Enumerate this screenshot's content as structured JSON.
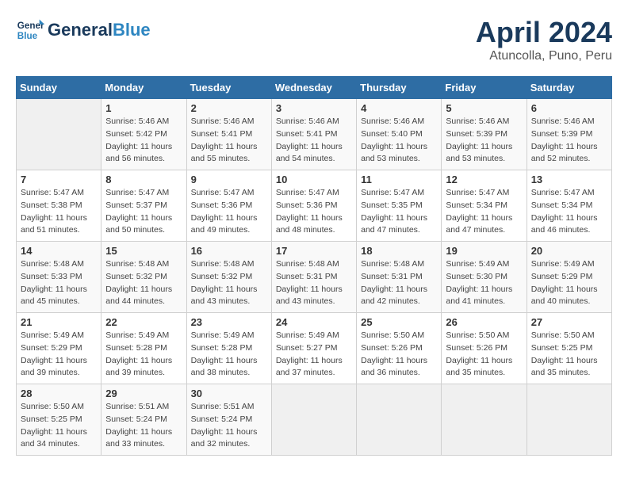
{
  "header": {
    "logo_line1": "General",
    "logo_line2": "Blue",
    "title": "April 2024",
    "subtitle": "Atuncolla, Puno, Peru"
  },
  "weekdays": [
    "Sunday",
    "Monday",
    "Tuesday",
    "Wednesday",
    "Thursday",
    "Friday",
    "Saturday"
  ],
  "weeks": [
    [
      {
        "day": "",
        "info": ""
      },
      {
        "day": "1",
        "info": "Sunrise: 5:46 AM\nSunset: 5:42 PM\nDaylight: 11 hours\nand 56 minutes."
      },
      {
        "day": "2",
        "info": "Sunrise: 5:46 AM\nSunset: 5:41 PM\nDaylight: 11 hours\nand 55 minutes."
      },
      {
        "day": "3",
        "info": "Sunrise: 5:46 AM\nSunset: 5:41 PM\nDaylight: 11 hours\nand 54 minutes."
      },
      {
        "day": "4",
        "info": "Sunrise: 5:46 AM\nSunset: 5:40 PM\nDaylight: 11 hours\nand 53 minutes."
      },
      {
        "day": "5",
        "info": "Sunrise: 5:46 AM\nSunset: 5:39 PM\nDaylight: 11 hours\nand 53 minutes."
      },
      {
        "day": "6",
        "info": "Sunrise: 5:46 AM\nSunset: 5:39 PM\nDaylight: 11 hours\nand 52 minutes."
      }
    ],
    [
      {
        "day": "7",
        "info": "Sunrise: 5:47 AM\nSunset: 5:38 PM\nDaylight: 11 hours\nand 51 minutes."
      },
      {
        "day": "8",
        "info": "Sunrise: 5:47 AM\nSunset: 5:37 PM\nDaylight: 11 hours\nand 50 minutes."
      },
      {
        "day": "9",
        "info": "Sunrise: 5:47 AM\nSunset: 5:36 PM\nDaylight: 11 hours\nand 49 minutes."
      },
      {
        "day": "10",
        "info": "Sunrise: 5:47 AM\nSunset: 5:36 PM\nDaylight: 11 hours\nand 48 minutes."
      },
      {
        "day": "11",
        "info": "Sunrise: 5:47 AM\nSunset: 5:35 PM\nDaylight: 11 hours\nand 47 minutes."
      },
      {
        "day": "12",
        "info": "Sunrise: 5:47 AM\nSunset: 5:34 PM\nDaylight: 11 hours\nand 47 minutes."
      },
      {
        "day": "13",
        "info": "Sunrise: 5:47 AM\nSunset: 5:34 PM\nDaylight: 11 hours\nand 46 minutes."
      }
    ],
    [
      {
        "day": "14",
        "info": "Sunrise: 5:48 AM\nSunset: 5:33 PM\nDaylight: 11 hours\nand 45 minutes."
      },
      {
        "day": "15",
        "info": "Sunrise: 5:48 AM\nSunset: 5:32 PM\nDaylight: 11 hours\nand 44 minutes."
      },
      {
        "day": "16",
        "info": "Sunrise: 5:48 AM\nSunset: 5:32 PM\nDaylight: 11 hours\nand 43 minutes."
      },
      {
        "day": "17",
        "info": "Sunrise: 5:48 AM\nSunset: 5:31 PM\nDaylight: 11 hours\nand 43 minutes."
      },
      {
        "day": "18",
        "info": "Sunrise: 5:48 AM\nSunset: 5:31 PM\nDaylight: 11 hours\nand 42 minutes."
      },
      {
        "day": "19",
        "info": "Sunrise: 5:49 AM\nSunset: 5:30 PM\nDaylight: 11 hours\nand 41 minutes."
      },
      {
        "day": "20",
        "info": "Sunrise: 5:49 AM\nSunset: 5:29 PM\nDaylight: 11 hours\nand 40 minutes."
      }
    ],
    [
      {
        "day": "21",
        "info": "Sunrise: 5:49 AM\nSunset: 5:29 PM\nDaylight: 11 hours\nand 39 minutes."
      },
      {
        "day": "22",
        "info": "Sunrise: 5:49 AM\nSunset: 5:28 PM\nDaylight: 11 hours\nand 39 minutes."
      },
      {
        "day": "23",
        "info": "Sunrise: 5:49 AM\nSunset: 5:28 PM\nDaylight: 11 hours\nand 38 minutes."
      },
      {
        "day": "24",
        "info": "Sunrise: 5:49 AM\nSunset: 5:27 PM\nDaylight: 11 hours\nand 37 minutes."
      },
      {
        "day": "25",
        "info": "Sunrise: 5:50 AM\nSunset: 5:26 PM\nDaylight: 11 hours\nand 36 minutes."
      },
      {
        "day": "26",
        "info": "Sunrise: 5:50 AM\nSunset: 5:26 PM\nDaylight: 11 hours\nand 35 minutes."
      },
      {
        "day": "27",
        "info": "Sunrise: 5:50 AM\nSunset: 5:25 PM\nDaylight: 11 hours\nand 35 minutes."
      }
    ],
    [
      {
        "day": "28",
        "info": "Sunrise: 5:50 AM\nSunset: 5:25 PM\nDaylight: 11 hours\nand 34 minutes."
      },
      {
        "day": "29",
        "info": "Sunrise: 5:51 AM\nSunset: 5:24 PM\nDaylight: 11 hours\nand 33 minutes."
      },
      {
        "day": "30",
        "info": "Sunrise: 5:51 AM\nSunset: 5:24 PM\nDaylight: 11 hours\nand 32 minutes."
      },
      {
        "day": "",
        "info": ""
      },
      {
        "day": "",
        "info": ""
      },
      {
        "day": "",
        "info": ""
      },
      {
        "day": "",
        "info": ""
      }
    ]
  ]
}
